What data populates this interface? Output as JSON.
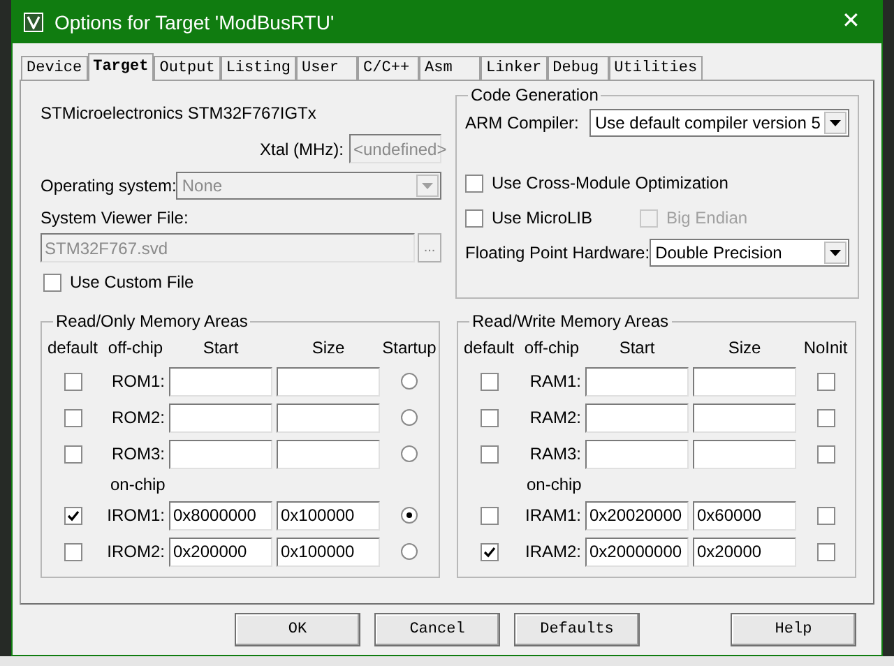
{
  "window": {
    "title": "Options for Target 'ModBusRTU'",
    "close": "✕"
  },
  "tabs": [
    {
      "label": "Device",
      "selected": false
    },
    {
      "label": "Target",
      "selected": true
    },
    {
      "label": "Output",
      "selected": false
    },
    {
      "label": "Listing",
      "selected": false
    },
    {
      "label": "User",
      "selected": false
    },
    {
      "label": "C/C++",
      "selected": false
    },
    {
      "label": "Asm",
      "selected": false
    },
    {
      "label": "Linker",
      "selected": false
    },
    {
      "label": "Debug",
      "selected": false
    },
    {
      "label": "Utilities",
      "selected": false
    }
  ],
  "device": "STMicroelectronics STM32F767IGTx",
  "xtal": {
    "label": "Xtal (MHz):",
    "value": "<undefined>",
    "disabled": true
  },
  "operating_system": {
    "label": "Operating system:",
    "value": "None",
    "disabled": true
  },
  "system_viewer": {
    "label": "System Viewer File:",
    "value": "STM32F767.svd",
    "browse": "...",
    "disabled": true
  },
  "use_custom_file": {
    "label": "Use Custom File",
    "checked": false
  },
  "code_generation": {
    "title": "Code Generation",
    "arm_compiler": {
      "label": "ARM Compiler:",
      "value": "Use default compiler version 5"
    },
    "cross_module": {
      "label": "Use Cross-Module Optimization",
      "checked": false,
      "disabled": false
    },
    "microlib": {
      "label": "Use MicroLIB",
      "checked": false,
      "disabled": false
    },
    "big_endian": {
      "label": "Big Endian",
      "checked": false,
      "disabled": true
    },
    "floating_point": {
      "label": "Floating Point Hardware:",
      "value": "Double Precision"
    }
  },
  "rom_areas": {
    "title": "Read/Only Memory Areas",
    "headers": [
      "default",
      "off-chip",
      "Start",
      "Size",
      "Startup"
    ],
    "on_chip_label": "on-chip",
    "off_chip_rows": [
      {
        "label": "ROM1:",
        "default": false,
        "start": "",
        "size": "",
        "selected": false
      },
      {
        "label": "ROM2:",
        "default": false,
        "start": "",
        "size": "",
        "selected": false
      },
      {
        "label": "ROM3:",
        "default": false,
        "start": "",
        "size": "",
        "selected": false
      }
    ],
    "on_chip_rows": [
      {
        "label": "IROM1:",
        "default": true,
        "start": "0x8000000",
        "size": "0x100000",
        "selected": true
      },
      {
        "label": "IROM2:",
        "default": false,
        "start": "0x200000",
        "size": "0x100000",
        "selected": false
      }
    ]
  },
  "ram_areas": {
    "title": "Read/Write Memory Areas",
    "headers": [
      "default",
      "off-chip",
      "Start",
      "Size",
      "NoInit"
    ],
    "on_chip_label": "on-chip",
    "off_chip_rows": [
      {
        "label": "RAM1:",
        "default": false,
        "start": "",
        "size": "",
        "noinit": false
      },
      {
        "label": "RAM2:",
        "default": false,
        "start": "",
        "size": "",
        "noinit": false
      },
      {
        "label": "RAM3:",
        "default": false,
        "start": "",
        "size": "",
        "noinit": false
      }
    ],
    "on_chip_rows": [
      {
        "label": "IRAM1:",
        "default": false,
        "start": "0x20020000",
        "size": "0x60000",
        "noinit": false
      },
      {
        "label": "IRAM2:",
        "default": true,
        "start": "0x20000000",
        "size": "0x20000",
        "noinit": false
      }
    ]
  },
  "buttons": [
    "OK",
    "Cancel",
    "Defaults",
    "Help"
  ]
}
